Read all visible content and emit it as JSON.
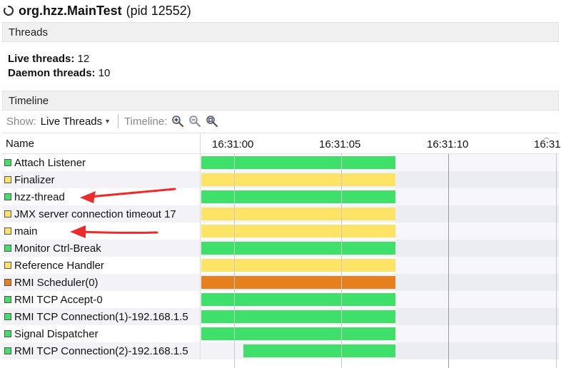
{
  "header": {
    "app_name": "org.hzz.MainTest",
    "pid_text": "(pid 12552)"
  },
  "threads_section": {
    "title": "Threads",
    "live_label": "Live threads:",
    "live_value": "12",
    "daemon_label": "Daemon threads:",
    "daemon_value": "10"
  },
  "timeline_section": {
    "title": "Timeline",
    "show_label": "Show:",
    "show_value": "Live Threads",
    "timeline_label": "Timeline:",
    "zoom_icons": [
      "zoom-in-icon",
      "zoom-out-icon",
      "zoom-fit-icon"
    ]
  },
  "table": {
    "name_header": "Name",
    "ticks": [
      "16:31:00",
      "16:31:05",
      "16:31:10",
      "16:31"
    ],
    "colors": {
      "running": "#3ee06a",
      "waiting": "#fde467",
      "timed_waiting": "#e6801f"
    },
    "rows": [
      {
        "name": "Attach Listener",
        "state": "running"
      },
      {
        "name": "Finalizer",
        "state": "waiting"
      },
      {
        "name": "hzz-thread",
        "state": "running"
      },
      {
        "name": "JMX server connection timeout 17",
        "state": "waiting"
      },
      {
        "name": "main",
        "state": "waiting"
      },
      {
        "name": "Monitor Ctrl-Break",
        "state": "running"
      },
      {
        "name": "Reference Handler",
        "state": "waiting"
      },
      {
        "name": "RMI Scheduler(0)",
        "state": "timed_waiting"
      },
      {
        "name": "RMI TCP Accept-0",
        "state": "running"
      },
      {
        "name": "RMI TCP Connection(1)-192.168.1.5",
        "state": "running"
      },
      {
        "name": "Signal Dispatcher",
        "state": "running"
      },
      {
        "name": "RMI TCP Connection(2)-192.168.1.5",
        "state": "running"
      }
    ]
  },
  "annotations": {
    "arrow_color": "#ee2b2b",
    "arrow_targets": [
      "hzz-thread",
      "main"
    ]
  }
}
